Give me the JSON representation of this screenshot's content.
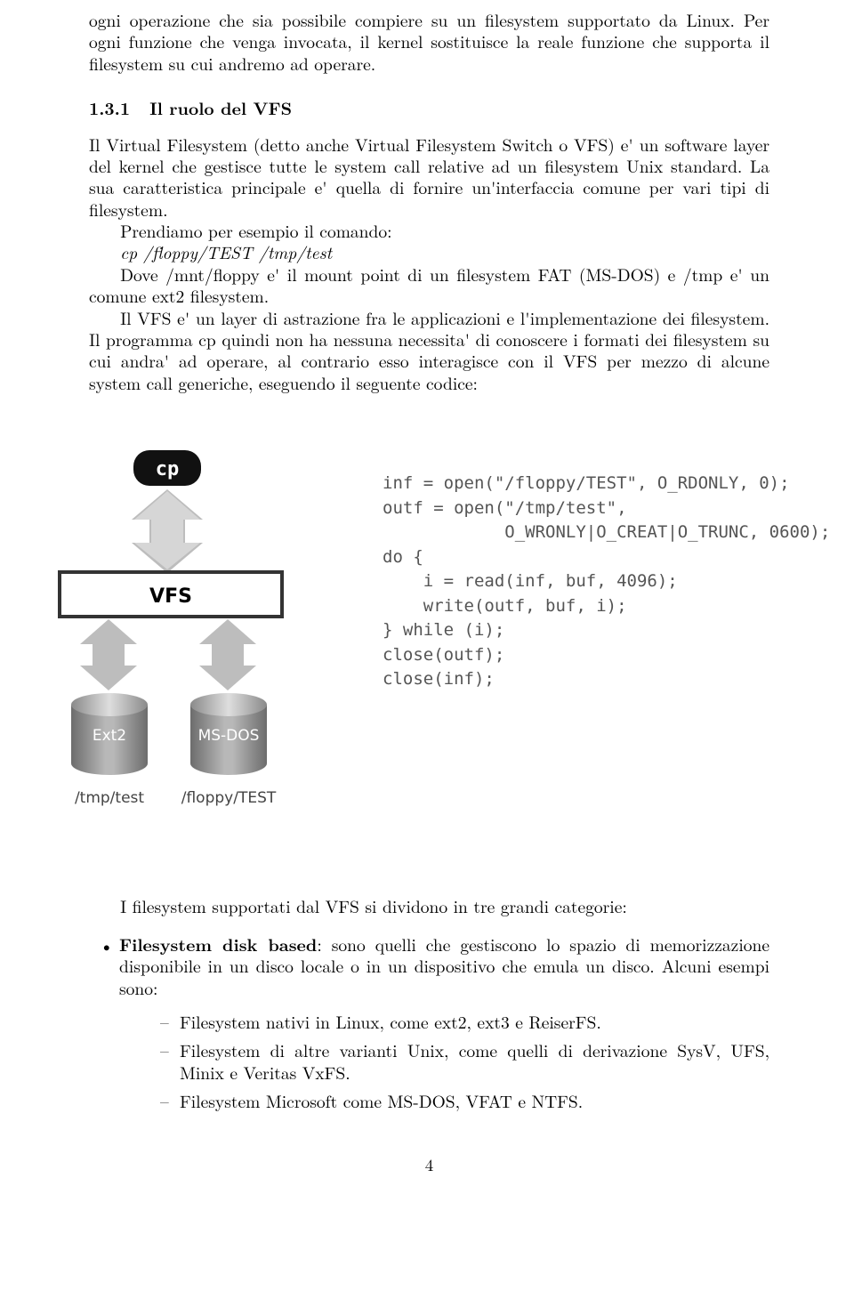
{
  "intro": {
    "p1": "ogni operazione che sia possibile compiere su un filesystem supportato da Linux. Per ogni funzione che venga invocata, il kernel sostituisce la reale funzione che supporta il filesystem su cui andremo ad operare."
  },
  "section": {
    "number": "1.3.1",
    "title": "Il ruolo del VFS"
  },
  "body": {
    "p2": "Il Virtual Filesystem (detto anche Virtual Filesystem Switch o VFS) e' un software layer del kernel che gestisce tutte le system call relative ad un filesystem Unix standard. La sua caratteristica principale e' quella di fornire un'interfaccia comune per vari tipi di filesystem.",
    "p3a": "Prendiamo per esempio il comando:",
    "p3b": "cp /floppy/TEST /tmp/test",
    "p3c": "Dove /mnt/floppy e' il mount point di un filesystem FAT (MS-DOS) e /tmp e' un comune ext2 filesystem.",
    "p4": "Il VFS e' un layer di astrazione fra le applicazioni e l'implementazione dei filesystem. Il programma cp quindi non ha nessuna necessita' di conoscere i formati dei filesystem su cui andra' ad operare, al contrario esso interagisce con il VFS per mezzo di alcune system call generiche, eseguendo il seguente codice:"
  },
  "figure": {
    "cp_label": "cp",
    "vfs_label": "VFS",
    "fs_labels": [
      "Ext2",
      "MS-DOS"
    ],
    "paths": [
      "/tmp/test",
      "/floppy/TEST"
    ],
    "code_lines": [
      "inf = open(\"/floppy/TEST\", O_RDONLY, 0);",
      "outf = open(\"/tmp/test\",",
      "            O_WRONLY|O_CREAT|O_TRUNC, 0600);",
      "do {",
      "    i = read(inf, buf, 4096);",
      "    write(outf, buf, i);",
      "} while (i);",
      "close(outf);",
      "close(inf);"
    ]
  },
  "categories": {
    "intro": "I filesystem supportati dal VFS si dividono in tre grandi categorie:",
    "item1_strong": "Filesystem disk based",
    "item1_rest": ": sono quelli che gestiscono lo spazio di memorizzazione disponibile in un disco locale o in un dispositivo che emula un disco. Alcuni esempi sono:",
    "sub1": "Filesystem nativi in Linux, come ext2, ext3 e ReiserFS.",
    "sub2": "Filesystem di altre varianti Unix, come quelli di derivazione SysV, UFS, Minix e Veritas VxFS.",
    "sub3": "Filesystem Microsoft come MS-DOS, VFAT e NTFS."
  },
  "page_number": "4"
}
